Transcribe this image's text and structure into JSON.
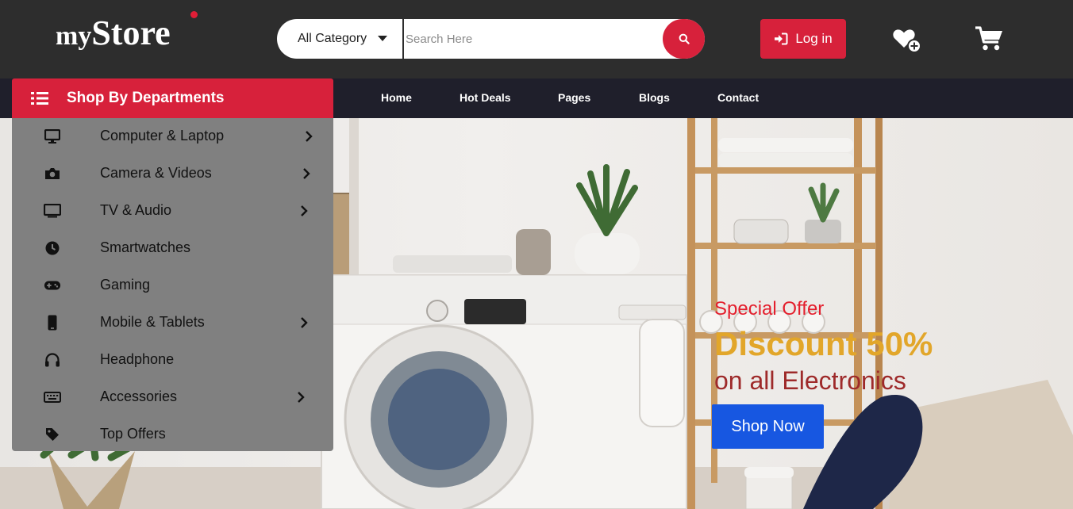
{
  "header": {
    "logo_prefix": "my",
    "logo_main": "Store",
    "category_select": "All Category",
    "search_placeholder": "Search Here",
    "login_label": "Log in",
    "icons": [
      "search-icon",
      "login-icon",
      "heart-plus-icon",
      "cart-icon"
    ]
  },
  "nav": {
    "departments_label": "Shop By Departments",
    "links": [
      "Home",
      "Hot Deals",
      "Pages",
      "Blogs",
      "Contact"
    ]
  },
  "departments": [
    {
      "label": "Computer & Laptop",
      "icon": "desktop-icon",
      "submenu": true
    },
    {
      "label": "Camera & Videos",
      "icon": "camera-icon",
      "submenu": true
    },
    {
      "label": "TV & Audio",
      "icon": "tv-icon",
      "submenu": true
    },
    {
      "label": "Smartwatches",
      "icon": "clock-icon",
      "submenu": false
    },
    {
      "label": "Gaming",
      "icon": "gamepad-icon",
      "submenu": false
    },
    {
      "label": "Mobile & Tablets",
      "icon": "mobile-icon",
      "submenu": true
    },
    {
      "label": "Headphone",
      "icon": "headphones-icon",
      "submenu": false
    },
    {
      "label": "Accessories",
      "icon": "keyboard-icon",
      "submenu": true
    },
    {
      "label": "Top Offers",
      "icon": "tag-icon",
      "submenu": false
    }
  ],
  "hero": {
    "offer_label": "Special Offer",
    "discount_label": "Discount 50%",
    "subtitle": "on all Electronics",
    "cta_label": "Shop Now"
  },
  "colors": {
    "header_bg": "#2d2d2d",
    "nav_bg": "#1f1f2b",
    "accent_red": "#d7213b",
    "cta_blue": "#1757e1",
    "discount_gold": "#e2a62a",
    "menu_bg": "#808080"
  }
}
